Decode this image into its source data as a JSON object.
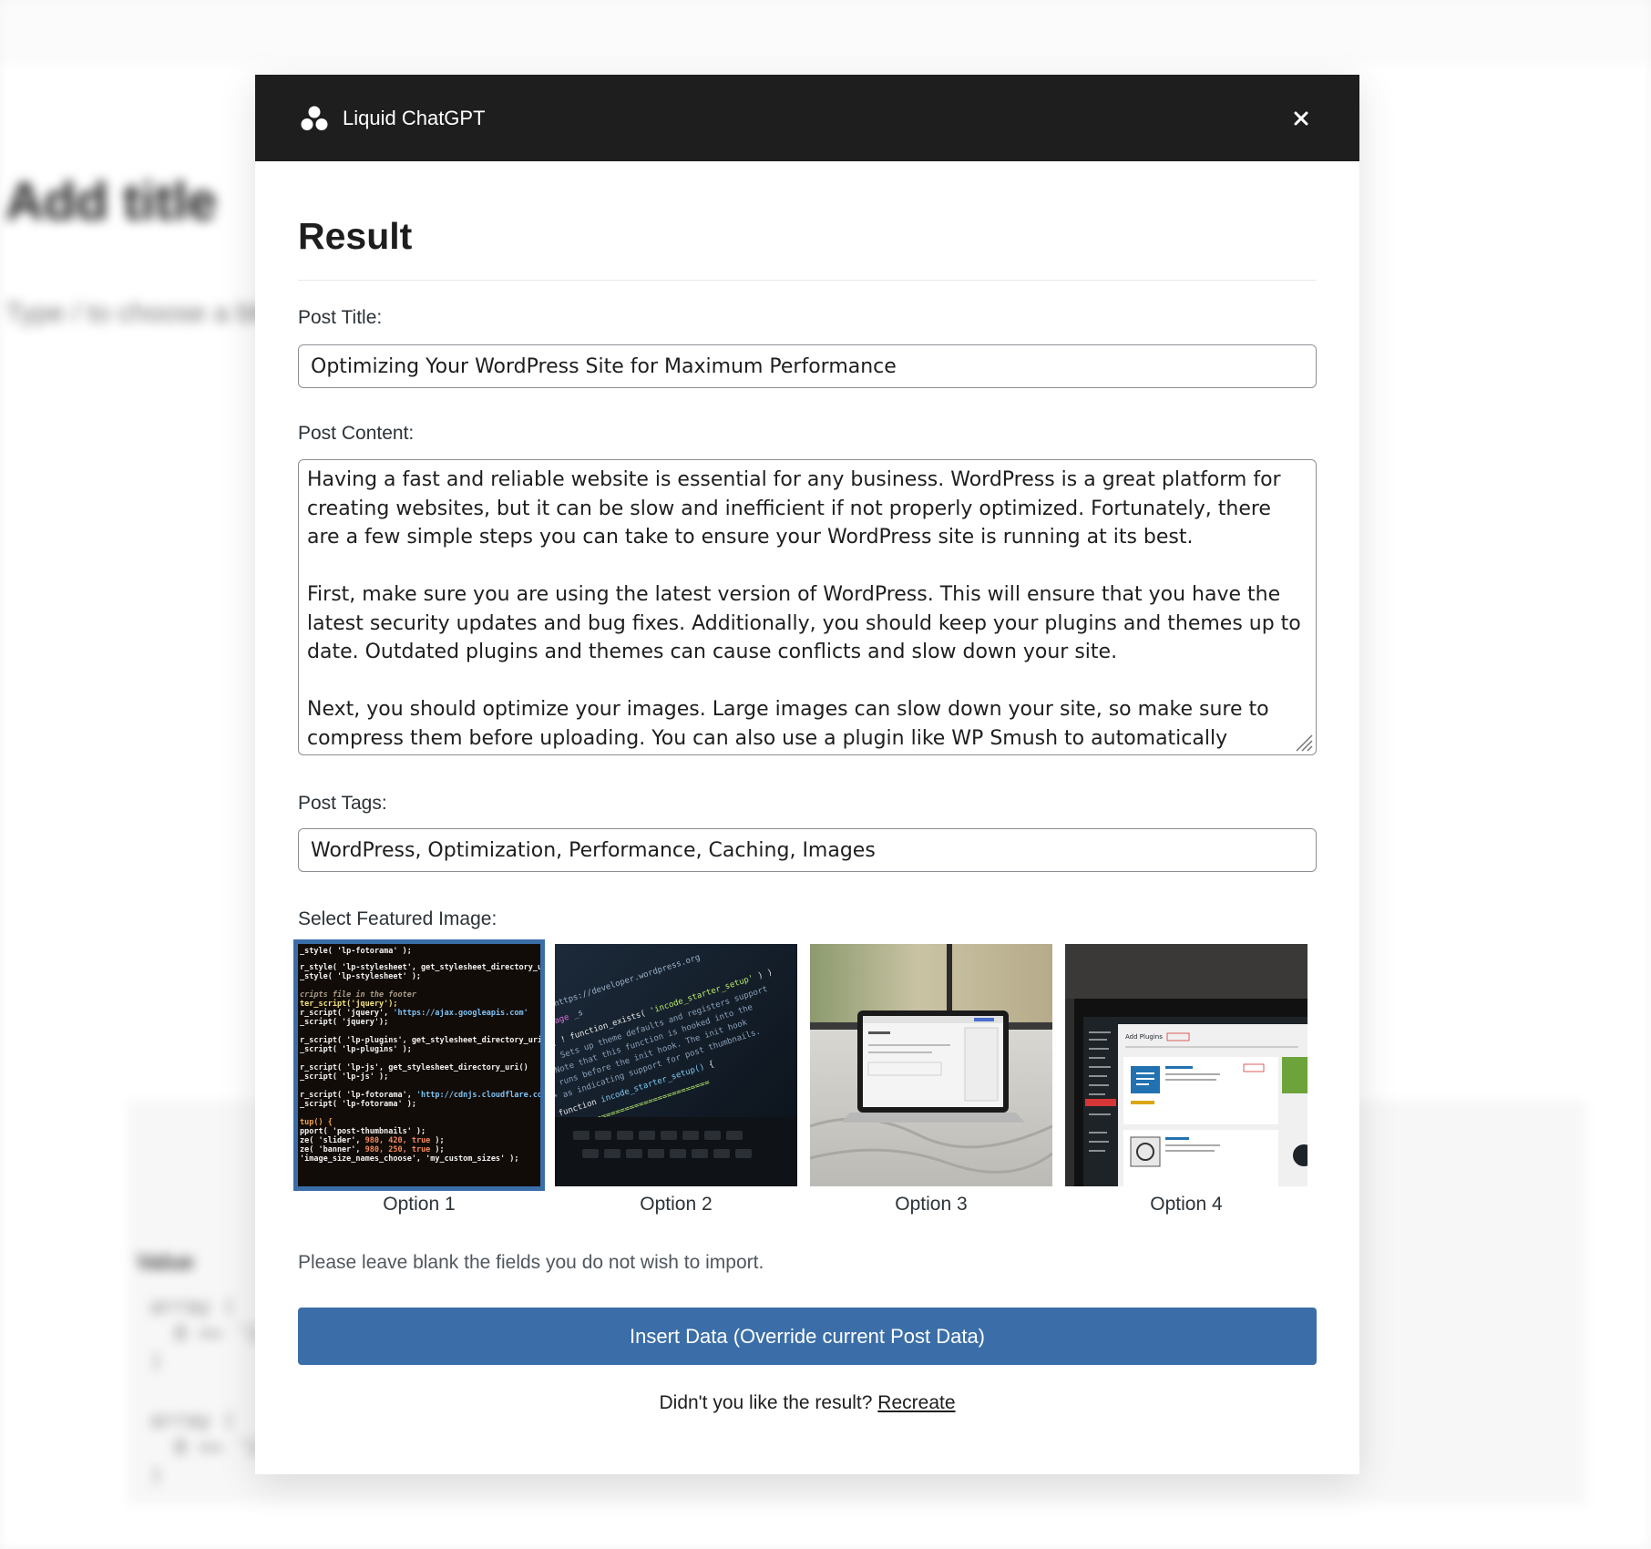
{
  "background": {
    "title_placeholder": "Add title",
    "block_hint": "Type / to choose a block",
    "panel_label": "Value",
    "code_blocks": [
      "array (\n  0 => '1\n)",
      "array (\n  0 => '1\n)"
    ]
  },
  "modal": {
    "brand": {
      "name": "Liquid ChatGPT",
      "icon": "three-circles-logo-icon"
    },
    "close_icon": "close-x-icon",
    "heading": "Result",
    "post_title": {
      "label": "Post Title:",
      "value": "Optimizing Your WordPress Site for Maximum Performance"
    },
    "post_content": {
      "label": "Post Content:",
      "value": "Having a fast and reliable website is essential for any business. WordPress is a great platform for creating websites, but it can be slow and inefficient if not properly optimized. Fortunately, there are a few simple steps you can take to ensure your WordPress site is running at its best.\n\nFirst, make sure you are using the latest version of WordPress. This will ensure that you have the latest security updates and bug fixes. Additionally, you should keep your plugins and themes up to date. Outdated plugins and themes can cause conflicts and slow down your site.\n\nNext, you should optimize your images. Large images can slow down your site, so make sure to compress them before uploading. You can also use a plugin like WP Smush to automatically compress images as"
    },
    "post_tags": {
      "label": "Post Tags:",
      "value": "WordPress, Optimization, Performance, Caching, Images"
    },
    "featured_image": {
      "label": "Select Featured Image:",
      "selected_index": 0,
      "options": [
        {
          "caption": "Option 1",
          "depicts": "code-on-screen-image"
        },
        {
          "caption": "Option 2",
          "depicts": "laptop-code-angled-image"
        },
        {
          "caption": "Option 3",
          "depicts": "laptop-on-bed-image"
        },
        {
          "caption": "Option 4",
          "depicts": "wordpress-plugins-screen-image"
        }
      ]
    },
    "note": "Please leave blank the fields you do not wish to import.",
    "insert_button": "Insert Data (Override current Post Data)",
    "recreate": {
      "question": "Didn't you like the result?",
      "link": "Recreate"
    },
    "colors": {
      "header_bg": "#1e1e1e",
      "accent": "#3b6ea8"
    }
  }
}
